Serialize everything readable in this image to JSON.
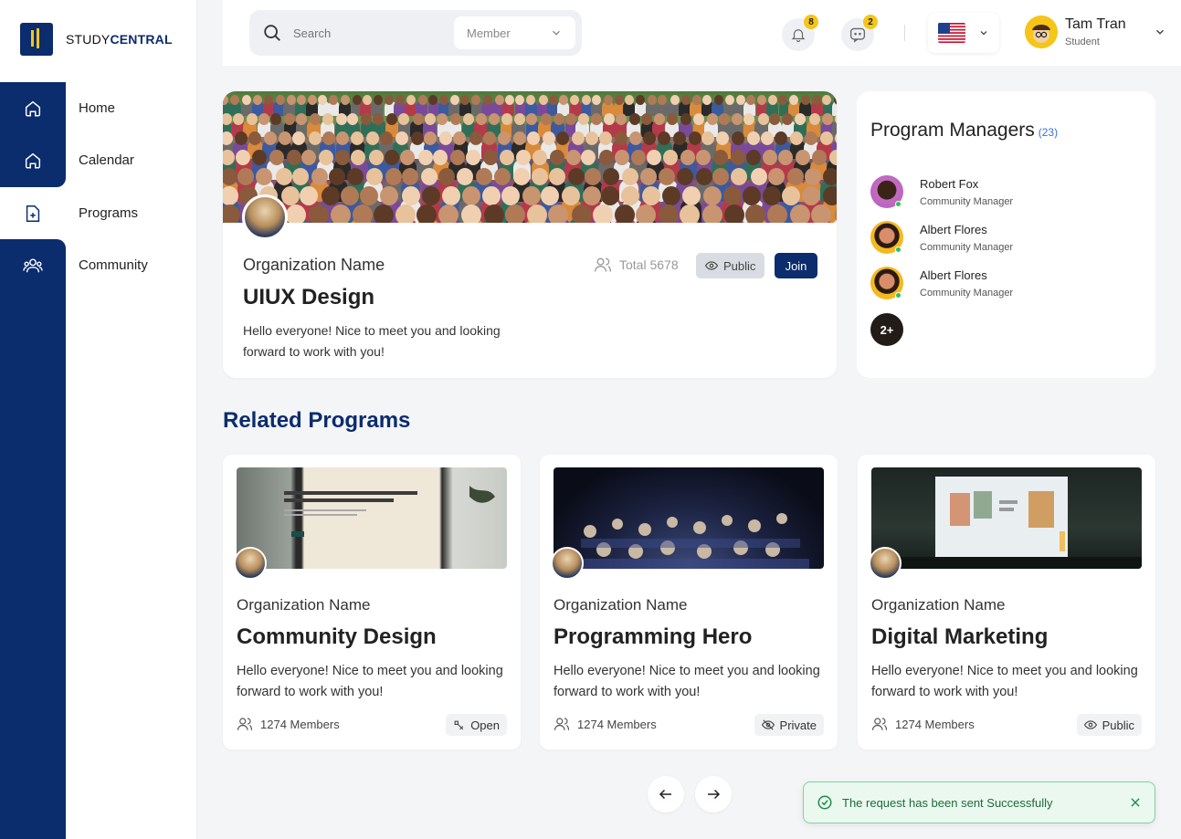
{
  "brand": {
    "prefix": "STUDY",
    "suffix": "CENTRAL"
  },
  "nav": {
    "items": [
      {
        "label": "Home",
        "icon": "home-icon"
      },
      {
        "label": "Calendar",
        "icon": "home-icon"
      },
      {
        "label": "Programs",
        "icon": "add-file-icon"
      },
      {
        "label": "Community",
        "icon": "users-icon"
      }
    ]
  },
  "header": {
    "search_placeholder": "Search",
    "search_filter": "Member",
    "notifications_count": "8",
    "messages_count": "2",
    "language": "US",
    "user": {
      "name": "Tam Tran",
      "role": "Student"
    }
  },
  "hero": {
    "org_name": "Organization Name",
    "title": "UIUX Design",
    "description": "Hello everyone! Nice to meet you and looking forward to work with you!",
    "total_label": "Total 5678",
    "visibility": "Public",
    "join_label": "Join"
  },
  "managers": {
    "title": "Program Managers",
    "count": "(23)",
    "list": [
      {
        "name": "Robert Fox",
        "role": "Community Manager"
      },
      {
        "name": "Albert Flores",
        "role": "Community Manager"
      },
      {
        "name": "Albert Flores",
        "role": "Community Manager"
      }
    ],
    "more_label": "2+"
  },
  "related": {
    "title": "Related Programs",
    "cards": [
      {
        "org_name": "Organization Name",
        "title": "Community Design",
        "description": "Hello everyone! Nice to meet you and looking forward to work with you!",
        "members": "1274 Members",
        "visibility": "Open",
        "visibility_icon": "open-access-icon"
      },
      {
        "org_name": "Organization Name",
        "title": "Programming Hero",
        "description": "Hello everyone! Nice to meet you and looking forward to work with you!",
        "members": "1274 Members",
        "visibility": "Private",
        "visibility_icon": "eye-off-icon"
      },
      {
        "org_name": "Organization Name",
        "title": "Digital Marketing",
        "description": "Hello everyone! Nice to meet you and looking forward to work with you!",
        "members": "1274 Members",
        "visibility": "Public",
        "visibility_icon": "eye-icon"
      }
    ]
  },
  "toast": {
    "message": "The request has been sent Successfully"
  },
  "colors": {
    "primary": "#0b2c6d",
    "accent": "#f5c518",
    "success": "#2fbf5b"
  }
}
